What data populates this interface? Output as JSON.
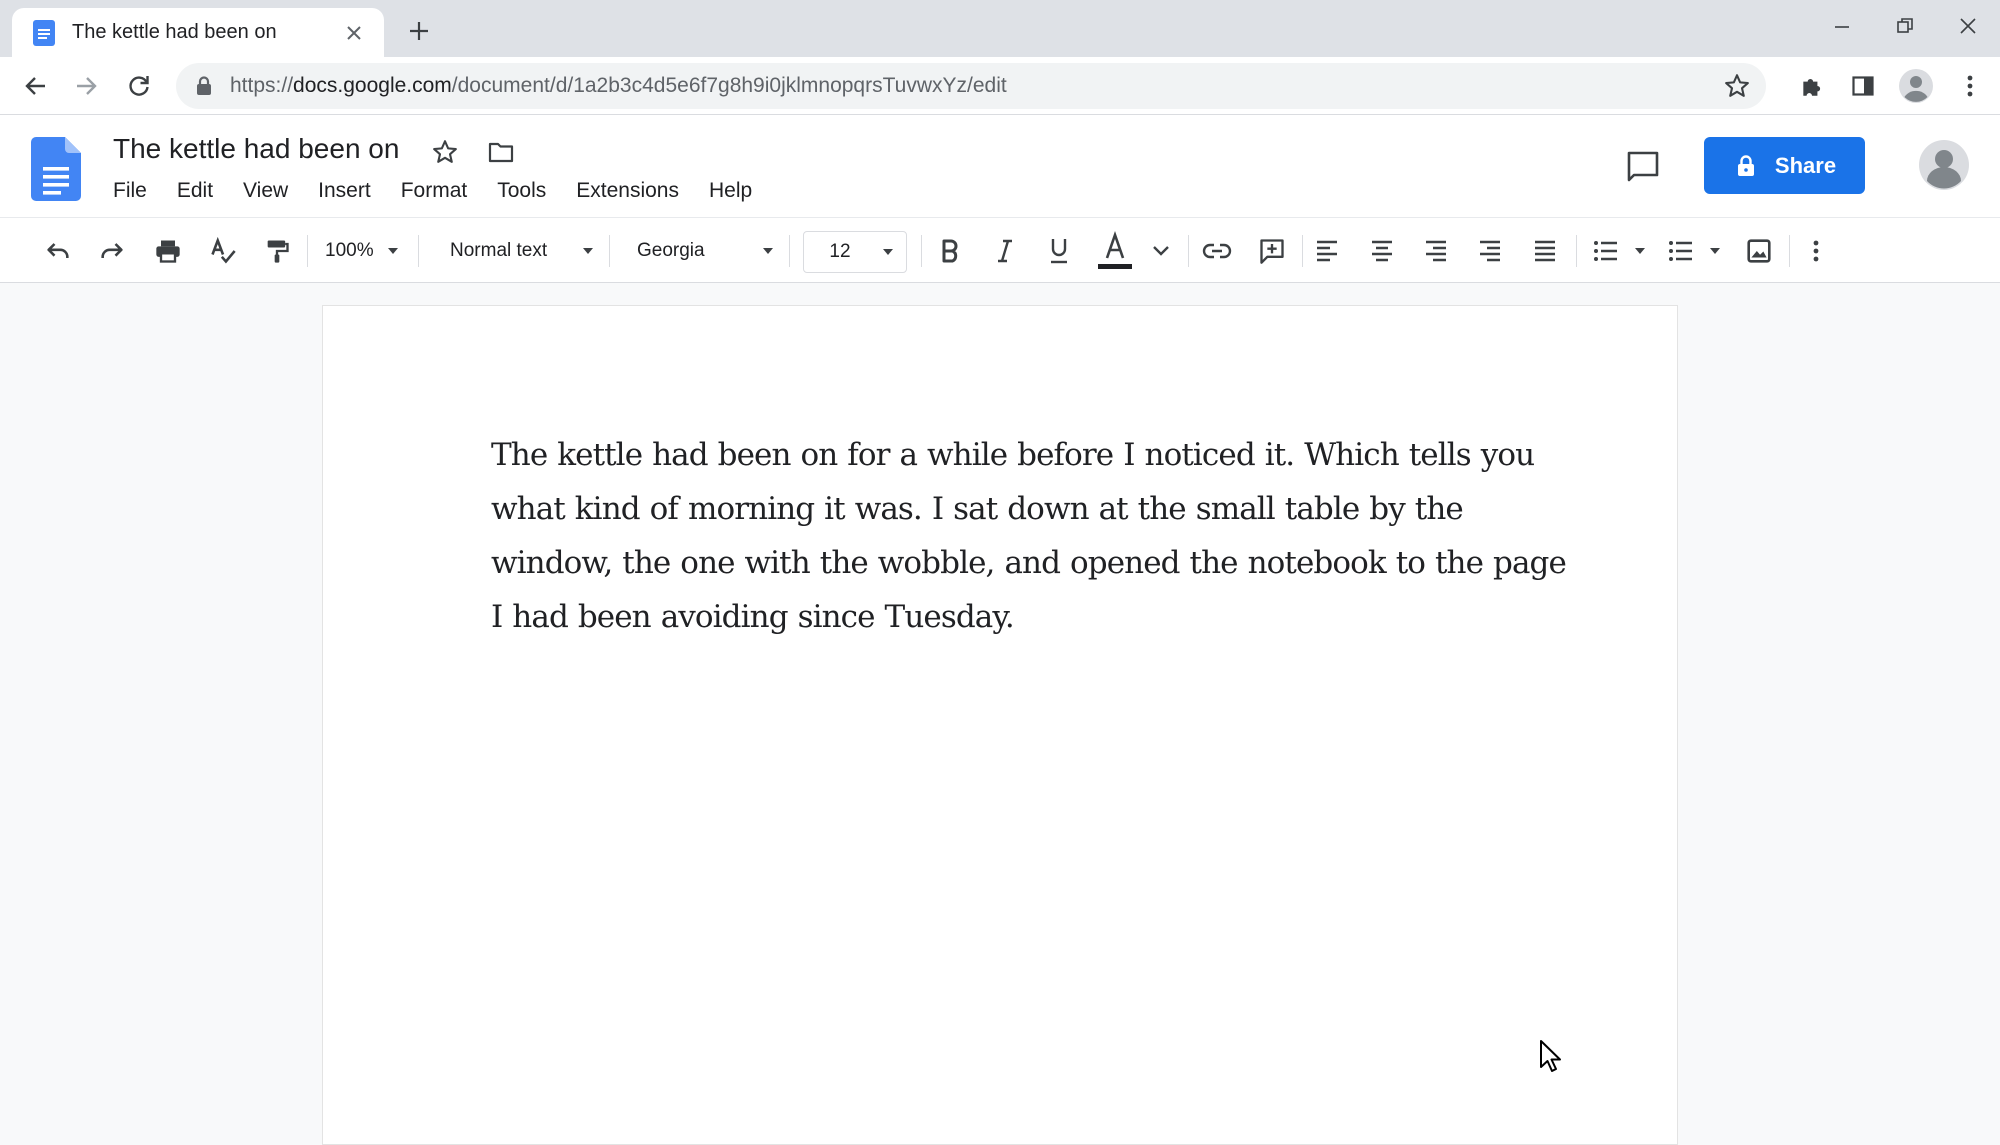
{
  "browser": {
    "tab_title": "The kettle had been on",
    "url_scheme": "https://",
    "url_host": "docs.google.com",
    "url_path": "/document/d/1a2b3c4d5e6f7g8h9i0jklmnopqrsTuvwxYz/edit"
  },
  "doc": {
    "title": "The kettle had been on",
    "menu": [
      "File",
      "Edit",
      "View",
      "Insert",
      "Format",
      "Tools",
      "Extensions",
      "Help"
    ],
    "share_label": "Share"
  },
  "toolbar": {
    "zoom": "100%",
    "style": "Normal text",
    "font": "Georgia",
    "font_size": "12"
  },
  "body_text": "The kettle had been on for a while before I noticed it.  Which tells you what kind of morning it was. I sat down at the small table by the window, the one with the wobble, and opened the notebook to the page I had been avoiding since Tuesday.",
  "colors": {
    "accent": "#1a73e8",
    "docs_blue": "#4285f4",
    "icon_grey": "#5f6368",
    "text": "#202124"
  },
  "icons": [
    "docs-favicon-icon",
    "close-icon",
    "plus-icon",
    "minimize-icon",
    "restore-icon",
    "window-close-icon",
    "back-arrow-icon",
    "forward-arrow-icon",
    "reload-icon",
    "lock-icon",
    "bookmark-star-icon",
    "extensions-icon",
    "side-panel-icon",
    "profile-icon",
    "more-vert-icon",
    "docs-logo-icon",
    "star-icon",
    "folder-icon",
    "comment-icon",
    "account-icon",
    "undo-icon",
    "redo-icon",
    "print-icon",
    "spellcheck-icon",
    "paint-format-icon",
    "bold-icon",
    "italic-icon",
    "underline-icon",
    "text-color-icon",
    "link-icon",
    "add-comment-icon",
    "align-left-icon",
    "align-center-icon",
    "align-right-icon",
    "align-justify-icon",
    "bulleted-list-icon",
    "numbered-list-icon",
    "image-icon",
    "mouse-cursor-icon"
  ]
}
